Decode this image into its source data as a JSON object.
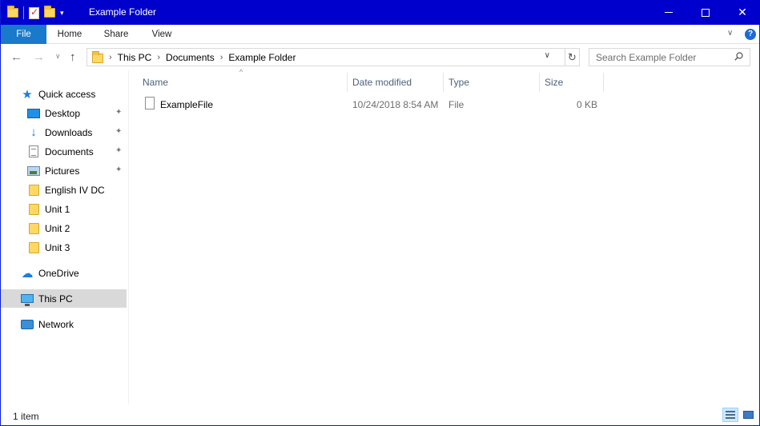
{
  "window": {
    "title": "Example Folder",
    "accent_color": "#0000cd"
  },
  "title_bar": {
    "controls": [
      "minimize-icon",
      "maximize-icon",
      "close-icon"
    ],
    "close_glyph": "✕"
  },
  "ribbon": {
    "tabs": [
      {
        "label": "File",
        "active": true,
        "color": "#1979ca"
      },
      {
        "label": "Home"
      },
      {
        "label": "Share"
      },
      {
        "label": "View"
      }
    ],
    "help_glyph": "?",
    "expand_glyph": "∨"
  },
  "navigation": {
    "back_glyph": "←",
    "forward_glyph": "→",
    "recent_glyph": "∨",
    "up_glyph": "↑",
    "breadcrumb": [
      "This PC",
      "Documents",
      "Example Folder"
    ],
    "crumb_separator": "›",
    "dropdown_glyph": "∨",
    "refresh_glyph": "↻",
    "search_placeholder": "Search Example Folder"
  },
  "sidebar": {
    "quick_access": "Quick access",
    "pinned": [
      {
        "label": "Desktop",
        "icon": "desktop-icon"
      },
      {
        "label": "Downloads",
        "icon": "downloads-icon"
      },
      {
        "label": "Documents",
        "icon": "documents-icon"
      },
      {
        "label": "Pictures",
        "icon": "pictures-icon"
      }
    ],
    "folders": [
      {
        "label": "English IV DC"
      },
      {
        "label": "Unit 1"
      },
      {
        "label": "Unit 2"
      },
      {
        "label": "Unit 3"
      }
    ],
    "onedrive": "OneDrive",
    "this_pc": "This PC",
    "network": "Network",
    "pin_glyph": "📌"
  },
  "file_list": {
    "sort_glyph": "^",
    "columns": [
      "Name",
      "Date modified",
      "Type",
      "Size"
    ],
    "rows": [
      {
        "name": "ExampleFile",
        "date_modified": "10/24/2018 8:54 AM",
        "type": "File",
        "size": "0 KB"
      }
    ]
  },
  "status_bar": {
    "item_count": "1 item"
  }
}
